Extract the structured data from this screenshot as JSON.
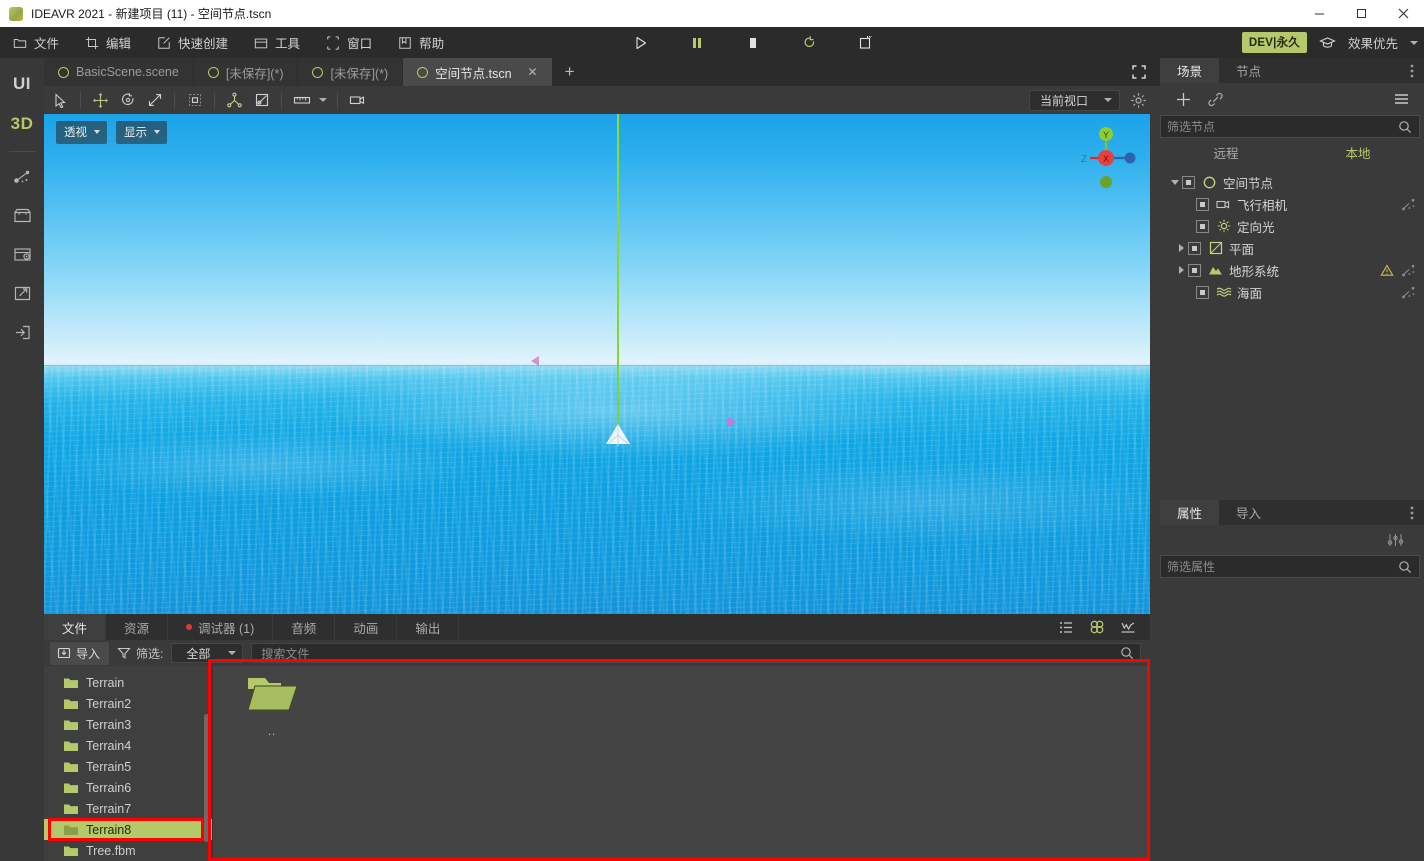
{
  "window": {
    "title": "IDEAVR 2021 - 新建项目 (11) - 空间节点.tscn",
    "minimize_label": "最小化",
    "maximize_label": "最大化",
    "close_label": "关闭"
  },
  "menubar": {
    "items": [
      {
        "label": "文件",
        "icon": "folder-icon"
      },
      {
        "label": "编辑",
        "icon": "crop-icon"
      },
      {
        "label": "快速创建",
        "icon": "edit-square-icon"
      },
      {
        "label": "工具",
        "icon": "toolbox-icon"
      },
      {
        "label": "窗口",
        "icon": "frame-icon"
      },
      {
        "label": "帮助",
        "icon": "book-icon"
      }
    ],
    "transport": [
      {
        "name": "play-button",
        "icon": "play-icon"
      },
      {
        "name": "pause-button",
        "icon": "pause-icon"
      },
      {
        "name": "stop-button",
        "icon": "stop-icon"
      },
      {
        "name": "reload-button",
        "icon": "reload-icon"
      },
      {
        "name": "remote-debug-button",
        "icon": "remote-device-icon"
      }
    ],
    "dev_badge": "DEV|永久",
    "graduation_icon": "graduation-cap-icon",
    "effect_select": "效果优先"
  },
  "rail": {
    "modes": [
      {
        "label": "UI",
        "active": false
      },
      {
        "label": "3D",
        "active": true
      }
    ],
    "icons": [
      {
        "name": "node-graph-icon"
      },
      {
        "name": "store-icon"
      },
      {
        "name": "asset-window-icon"
      },
      {
        "name": "export-icon"
      },
      {
        "name": "exit-icon"
      }
    ]
  },
  "scene_tabs": {
    "tabs": [
      {
        "label": "BasicScene.scene",
        "active": false,
        "closable": false
      },
      {
        "label": "[未保存](*)",
        "active": false,
        "closable": false
      },
      {
        "label": "[未保存](*)",
        "active": false,
        "closable": false
      },
      {
        "label": "空间节点.tscn",
        "active": true,
        "closable": true
      }
    ],
    "add_label": "+",
    "close_label": "✕",
    "fullscreen_icon": "fullscreen-icon"
  },
  "view_toolbar": {
    "tools": [
      {
        "name": "select-tool",
        "icon": "cursor-icon"
      },
      {
        "name": "move-tool",
        "icon": "move-arrows-icon"
      },
      {
        "name": "rotate-tool",
        "icon": "rotate-icon"
      },
      {
        "name": "scale-tool",
        "icon": "scale-icon"
      },
      {
        "name": "bounding-box-tool",
        "icon": "bounding-box-icon"
      },
      {
        "name": "snap-tool",
        "icon": "snap-pivot-icon"
      },
      {
        "name": "local-space-tool",
        "icon": "local-space-icon"
      },
      {
        "name": "ruler-tool",
        "icon": "ruler-icon"
      },
      {
        "name": "camera-tool",
        "icon": "camera-icon"
      }
    ],
    "viewport_select": "当前视口",
    "settings_icon": "gear-icon"
  },
  "viewport": {
    "perspective_label": "透视",
    "display_label": "显示",
    "gizmo_axes": {
      "y": "Y",
      "x": "X",
      "z": "Z"
    }
  },
  "bottom_panel": {
    "tabs": [
      {
        "label": "文件",
        "active": true,
        "dot": false
      },
      {
        "label": "资源",
        "active": false,
        "dot": false
      },
      {
        "label": "调试器 (1)",
        "active": false,
        "dot": true
      },
      {
        "label": "音频",
        "active": false,
        "dot": false
      },
      {
        "label": "动画",
        "active": false,
        "dot": false
      },
      {
        "label": "输出",
        "active": false,
        "dot": false
      }
    ],
    "right_icons": [
      {
        "name": "list-view-icon"
      },
      {
        "name": "clover-icon"
      },
      {
        "name": "download-icon"
      }
    ],
    "import_label": "导入",
    "filter_label": "筛选:",
    "filter_value": "全部",
    "search_placeholder": "搜索文件",
    "folders": [
      {
        "label": "Terrain",
        "selected": false
      },
      {
        "label": "Terrain2",
        "selected": false
      },
      {
        "label": "Terrain3",
        "selected": false
      },
      {
        "label": "Terrain4",
        "selected": false
      },
      {
        "label": "Terrain5",
        "selected": false
      },
      {
        "label": "Terrain6",
        "selected": false
      },
      {
        "label": "Terrain7",
        "selected": false
      },
      {
        "label": "Terrain8",
        "selected": true
      },
      {
        "label": "Tree.fbm",
        "selected": false
      }
    ],
    "grid_items": [
      {
        "label": "..",
        "icon": "open-folder-icon"
      }
    ]
  },
  "scene_dock": {
    "tabs": [
      {
        "label": "场景",
        "active": true
      },
      {
        "label": "节点",
        "active": false
      }
    ],
    "menu_icon": "vertical-dots-icon",
    "toolbar": [
      {
        "name": "add-node-button",
        "icon": "plus-icon"
      },
      {
        "name": "link-node-button",
        "icon": "link-icon"
      },
      {
        "name": "node-menu-button",
        "icon": "hamburger-icon"
      }
    ],
    "filter_placeholder": "筛选节点",
    "remote_label": "远程",
    "local_label": "本地",
    "tree": [
      {
        "label": "空间节点",
        "depth": 0,
        "icon": "circle-node-icon",
        "expander": "open",
        "warning": false,
        "anim": false
      },
      {
        "label": "飞行相机",
        "depth": 1,
        "icon": "camera-node-icon",
        "expander": "none",
        "warning": false,
        "anim": true
      },
      {
        "label": "定向光",
        "depth": 1,
        "icon": "sun-light-icon",
        "expander": "none",
        "warning": false,
        "anim": false
      },
      {
        "label": "平面",
        "depth": 1,
        "icon": "plane-mesh-icon",
        "expander": "closed",
        "warning": false,
        "anim": false
      },
      {
        "label": "地形系统",
        "depth": 1,
        "icon": "terrain-icon",
        "expander": "closed",
        "warning": true,
        "anim": true
      },
      {
        "label": "海面",
        "depth": 1,
        "icon": "water-wave-icon",
        "expander": "none",
        "warning": false,
        "anim": true
      }
    ]
  },
  "property_dock": {
    "tabs": [
      {
        "label": "属性",
        "active": true
      },
      {
        "label": "导入",
        "active": false
      }
    ],
    "menu_icon": "vertical-dots-icon",
    "sliders_icon": "sliders-icon",
    "filter_placeholder": "筛选属性"
  },
  "colors": {
    "accent_green": "#b5c96a",
    "annotation_red": "#ff0000",
    "debug_dot": "#e03b2f",
    "panel_bg": "#3a3a3a",
    "dark_bg": "#2b2b2b"
  }
}
